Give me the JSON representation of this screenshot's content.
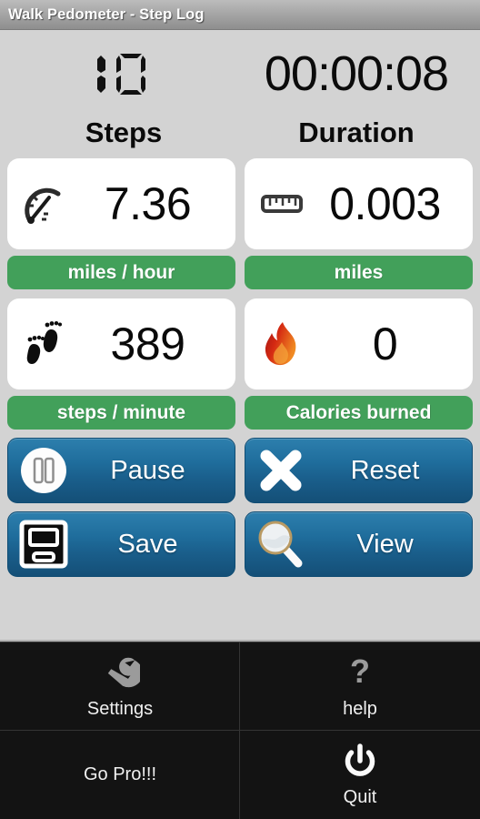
{
  "window": {
    "title": "Walk Pedometer - Step Log"
  },
  "readouts": {
    "steps": {
      "label": "Steps",
      "value": "10",
      "display": "lcd-segment"
    },
    "duration": {
      "label": "Duration",
      "value": "00:00:08"
    }
  },
  "metrics": [
    {
      "icon": "speedometer-icon",
      "value": "7.36",
      "unit_label": "miles / hour"
    },
    {
      "icon": "ruler-icon",
      "value": "0.003",
      "unit_label": "miles"
    },
    {
      "icon": "footprints-icon",
      "value": "389",
      "unit_label": "steps / minute"
    },
    {
      "icon": "flame-icon",
      "value": "0",
      "unit_label": "Calories burned"
    }
  ],
  "actions": [
    {
      "id": "pause",
      "label": "Pause",
      "icon": "pause-icon"
    },
    {
      "id": "reset",
      "label": "Reset",
      "icon": "close-x-icon"
    },
    {
      "id": "save",
      "label": "Save",
      "icon": "floppy-disk-icon"
    },
    {
      "id": "view",
      "label": "View",
      "icon": "magnifier-icon"
    }
  ],
  "menu": [
    {
      "id": "settings",
      "label": "Settings",
      "icon": "wrench-icon"
    },
    {
      "id": "help",
      "label": "help",
      "icon": "question-mark-icon"
    },
    {
      "id": "go-pro",
      "label": "Go Pro!!!",
      "icon": "none"
    },
    {
      "id": "quit",
      "label": "Quit",
      "icon": "power-icon"
    }
  ],
  "colors": {
    "accent_green": "#42a05a",
    "button_blue": "#1f6d9c",
    "panel_background": "#d3d3d3",
    "menu_background": "#131313"
  }
}
